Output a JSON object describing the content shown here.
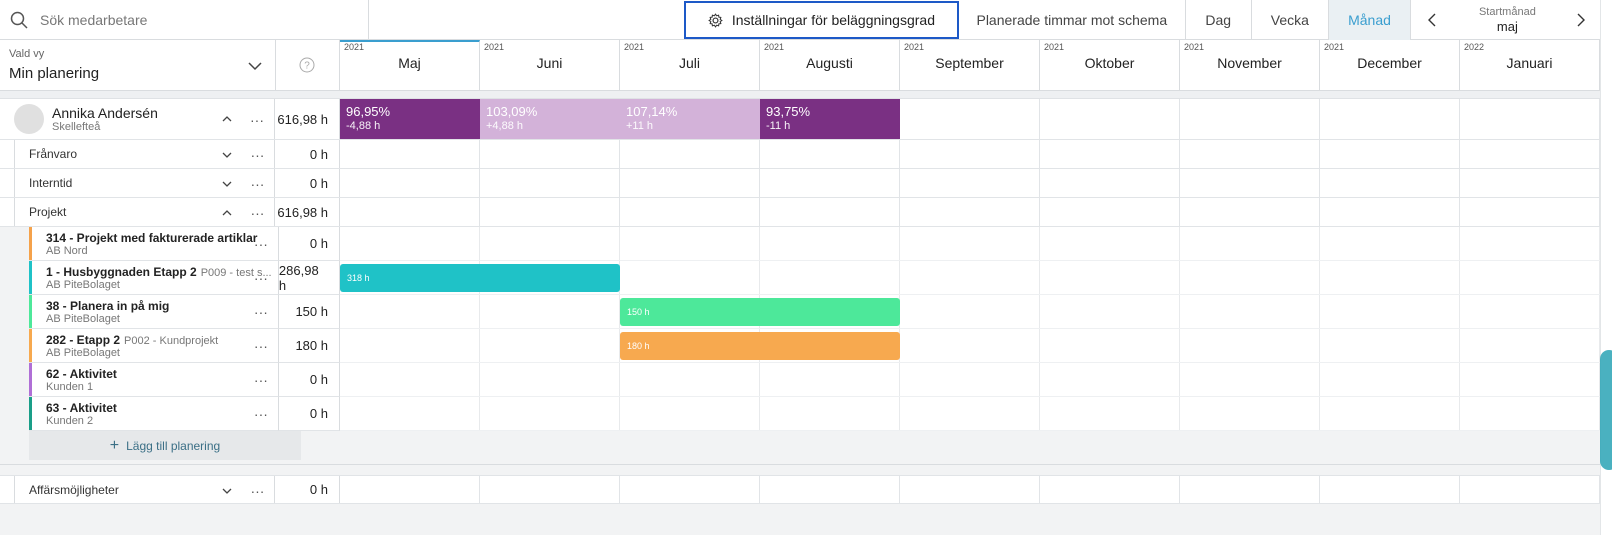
{
  "search": {
    "placeholder": "Sök medarbetare"
  },
  "toolbar": {
    "settings_label": "Inställningar för beläggningsgrad",
    "hours_vs_schedule": "Planerade timmar mot schema",
    "day": "Dag",
    "week": "Vecka",
    "month": "Månad",
    "start_month_label": "Startmånad",
    "start_month_value": "maj"
  },
  "view": {
    "label": "Vald vy",
    "value": "Min planering"
  },
  "months": [
    {
      "year": "2021",
      "name": "Maj"
    },
    {
      "year": "2021",
      "name": "Juni"
    },
    {
      "year": "2021",
      "name": "Juli"
    },
    {
      "year": "2021",
      "name": "Augusti"
    },
    {
      "year": "2021",
      "name": "September"
    },
    {
      "year": "2021",
      "name": "Oktober"
    },
    {
      "year": "2021",
      "name": "November"
    },
    {
      "year": "2021",
      "name": "December"
    },
    {
      "year": "2022",
      "name": "Januari"
    }
  ],
  "person": {
    "name": "Annika Andersén",
    "location": "Skellefteå",
    "hours": "616,98 h",
    "occupancy": [
      {
        "pct": "96,95%",
        "diff": "-4,88 h",
        "tone": "dark"
      },
      {
        "pct": "103,09%",
        "diff": "+4,88 h",
        "tone": "light"
      },
      {
        "pct": "107,14%",
        "diff": "+11 h",
        "tone": "light"
      },
      {
        "pct": "93,75%",
        "diff": "-11 h",
        "tone": "dark"
      }
    ]
  },
  "categories": [
    {
      "label": "Frånvaro",
      "hours": "0 h"
    },
    {
      "label": "Interntid",
      "hours": "0 h"
    },
    {
      "label": "Projekt",
      "hours": "616,98 h"
    }
  ],
  "projects": [
    {
      "title": "314 - Projekt med fakturerade artiklar",
      "sub": "",
      "customer": "AB Nord",
      "hours": "0 h",
      "color": "#f5a24b"
    },
    {
      "title": "1 - Husbyggnaden Etapp 2",
      "sub": "P009 - test s...",
      "customer": "AB PiteBolaget",
      "hours": "286,98 h",
      "color": "#1fc2c7",
      "bar": {
        "label": "318 h",
        "start": 0,
        "span": 2,
        "color": "#1fc2c7"
      }
    },
    {
      "title": "38 - Planera in på mig",
      "sub": "",
      "customer": "AB PiteBolaget",
      "hours": "150 h",
      "color": "#4de89a",
      "bar": {
        "label": "150 h",
        "start": 2,
        "span": 2,
        "color": "#4de89a"
      }
    },
    {
      "title": "282 - Etapp 2",
      "sub": "P002 - Kundprojekt",
      "customer": "AB PiteBolaget",
      "hours": "180 h",
      "color": "#f7a94f",
      "bar": {
        "label": "180 h",
        "start": 2,
        "span": 2,
        "color": "#f7a94f"
      }
    },
    {
      "title": "62 - Aktivitet",
      "sub": "",
      "customer": "Kunden 1",
      "hours": "0 h",
      "color": "#b06fd6"
    },
    {
      "title": "63 - Aktivitet",
      "sub": "",
      "customer": "Kunden 2",
      "hours": "0 h",
      "color": "#1a9e88"
    }
  ],
  "add_planning_label": "Lägg till planering",
  "opportunities": {
    "label": "Affärsmöjligheter",
    "hours": "0 h"
  },
  "more_glyph": "···"
}
